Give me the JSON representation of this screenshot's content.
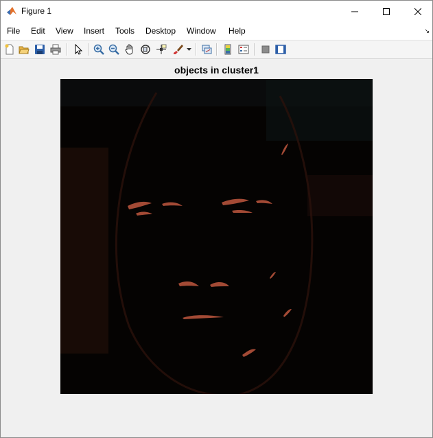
{
  "window": {
    "title": "Figure 1"
  },
  "menu": {
    "items": [
      "File",
      "Edit",
      "View",
      "Insert",
      "Tools",
      "Desktop",
      "Window",
      "Help"
    ]
  },
  "toolbar": {
    "buttons": [
      "new-figure-icon",
      "open-file-icon",
      "save-icon",
      "print-icon",
      "edit-plot-arrow-icon",
      "zoom-in-icon",
      "zoom-out-icon",
      "pan-hand-icon",
      "rotate-3d-icon",
      "data-cursor-icon",
      "brush-icon",
      "brush-dropdown-icon",
      "link-plot-icon",
      "colorbar-icon",
      "legend-icon",
      "hide-plot-tools-icon",
      "show-plot-tools-icon"
    ]
  },
  "axes": {
    "title": "objects in cluster1"
  },
  "colors": {
    "image_background": "#050302",
    "highlight": "#a34a35"
  }
}
